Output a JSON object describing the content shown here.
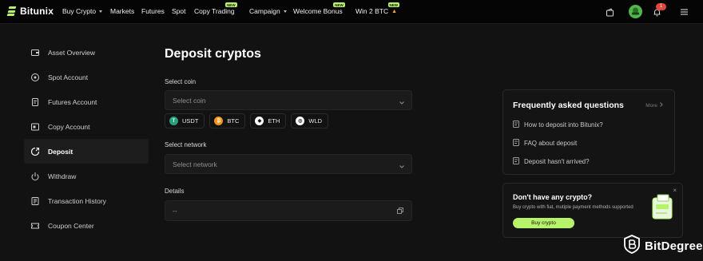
{
  "brand": {
    "name": "Bitunix",
    "accent": "#b6f36a"
  },
  "nav": {
    "items": [
      {
        "label": "Buy Crypto",
        "dropdown": true
      },
      {
        "label": "Markets"
      },
      {
        "label": "Futures"
      },
      {
        "label": "Spot"
      },
      {
        "label": "Copy Trading",
        "tag": "NEW"
      },
      {
        "label": "Campaign",
        "dropdown": true
      },
      {
        "label": "Welcome Bonus",
        "tag": "NEW"
      },
      {
        "label": "Win 2 BTC",
        "tag": "NEW"
      }
    ],
    "notification_count": "1"
  },
  "sidebar": {
    "items": [
      {
        "label": "Asset Overview",
        "icon": "wallet-icon"
      },
      {
        "label": "Spot Account",
        "icon": "coin-icon"
      },
      {
        "label": "Futures Account",
        "icon": "document-icon"
      },
      {
        "label": "Copy Account",
        "icon": "copy-account-icon"
      },
      {
        "label": "Deposit",
        "icon": "deposit-icon",
        "active": true
      },
      {
        "label": "Withdraw",
        "icon": "power-icon"
      },
      {
        "label": "Transaction History",
        "icon": "history-icon"
      },
      {
        "label": "Coupon Center",
        "icon": "coupon-icon"
      }
    ]
  },
  "main": {
    "title": "Deposit cryptos",
    "select_coin_label": "Select coin",
    "select_coin_placeholder": "Select coin",
    "coins": [
      {
        "symbol": "USDT",
        "color": "#26a17b",
        "glyph": "T"
      },
      {
        "symbol": "BTC",
        "color": "#f7931a",
        "glyph": "₿"
      },
      {
        "symbol": "ETH",
        "color": "#2b2b2b",
        "glyph": "◆"
      },
      {
        "symbol": "WLD",
        "color": "#3a3a3a",
        "glyph": "◎"
      }
    ],
    "select_network_label": "Select network",
    "select_network_placeholder": "Select network",
    "details_label": "Details",
    "details_value": "--"
  },
  "faq": {
    "title": "Frequently asked questions",
    "more_label": "More",
    "items": [
      "How to deposit into Bitunix?",
      "FAQ about deposit",
      "Deposit hasn't arrived?"
    ]
  },
  "promo": {
    "title": "Don't have any crypto?",
    "subtitle": "Buy crypto with fiat, mutiple payment methods supported",
    "button_label": "Buy crypto",
    "close": "×"
  },
  "watermark": {
    "text": "BitDegree"
  }
}
